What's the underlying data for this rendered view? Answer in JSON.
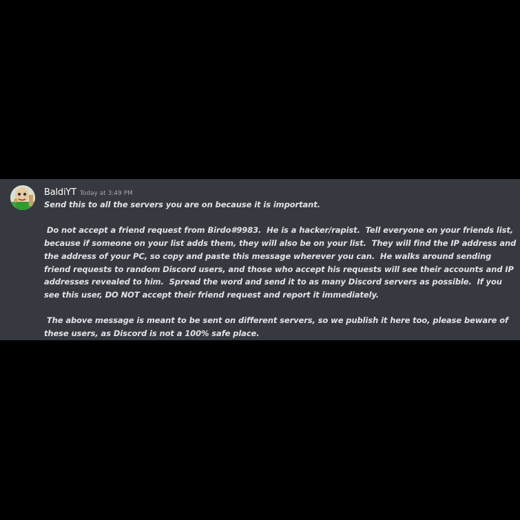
{
  "message": {
    "author": "BaldiYT",
    "timestamp": "Today at 3:49 PM",
    "avatar_icon": "baldi-avatar-icon",
    "paragraphs": [
      "Send this to all the servers you are on because it is important.",
      " Do not accept a friend request from Birdo#9983.  He is a hacker/rapist.  Tell everyone on your friends list, because if someone on your list adds them, they will also be on your list.  They will find the IP address and the address of your PC, so copy and paste this message wherever you can.  He walks around sending friend requests to random Discord users, and those who accept his requests will see their accounts and IP addresses revealed to him.  Spread the word and send it to as many Discord servers as possible.  If you see this user, DO NOT accept their friend request and report it immediately.",
      " The above message is meant to be sent on different servers, so we publish it here too, please beware of these users, as Discord is not a 100% safe place."
    ]
  },
  "colors": {
    "background": "#000000",
    "message_panel": "#36393f",
    "username": "#ffffff",
    "timestamp": "#a3a6aa",
    "text": "#e1e3e6"
  }
}
